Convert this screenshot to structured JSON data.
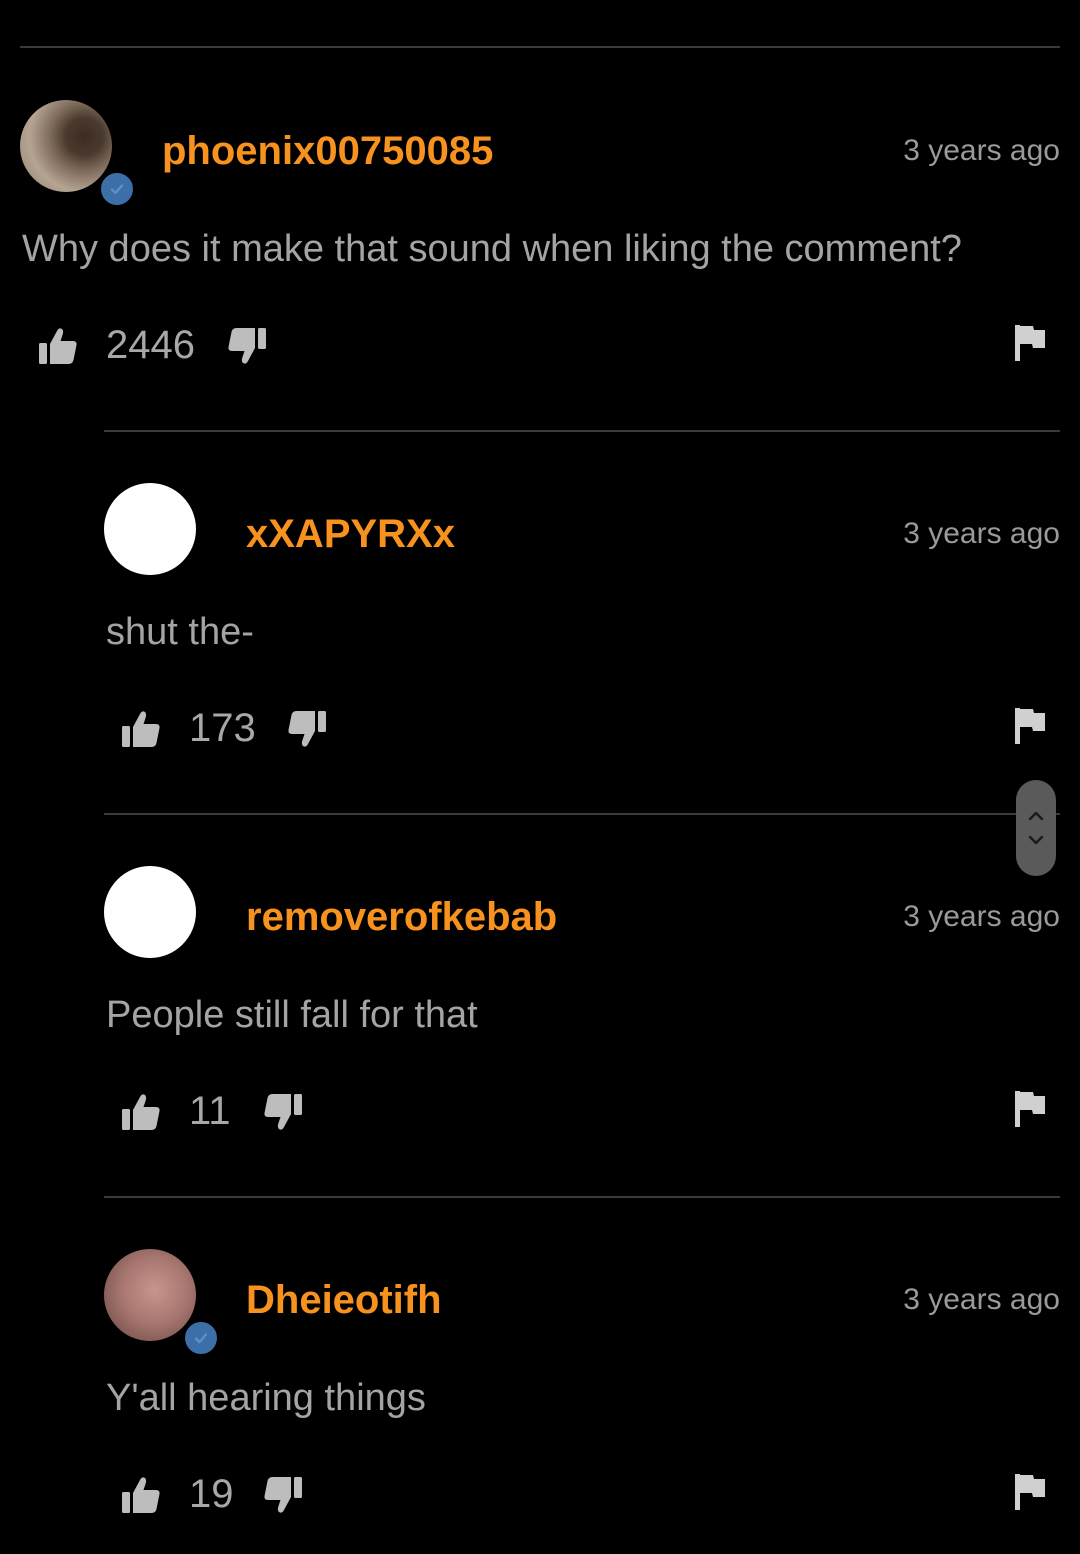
{
  "comments": [
    {
      "username": "phoenix00750085",
      "time": "3 years ago",
      "text": "Why does it make that sound when liking the comment?",
      "likes": "2446",
      "verified": true
    },
    {
      "username": "xXAPYRXx",
      "time": "3 years ago",
      "text": "shut the-",
      "likes": "173",
      "verified": false
    },
    {
      "username": "removerofkebab",
      "time": "3 years ago",
      "text": "People still fall for that",
      "likes": "11",
      "verified": false
    },
    {
      "username": "Dheieotifh",
      "time": "3 years ago",
      "text": "Y'all hearing things",
      "likes": "19",
      "verified": true
    }
  ],
  "icons": {
    "like": "thumbs-up-icon",
    "dislike": "thumbs-down-icon",
    "report": "flag-icon",
    "verified": "verified-check-icon",
    "scroll_up": "chevron-up-icon",
    "scroll_down": "chevron-down-icon"
  },
  "colors": {
    "username": "#f7921e",
    "background": "#000000",
    "verified_badge": "#3c6ea8"
  }
}
